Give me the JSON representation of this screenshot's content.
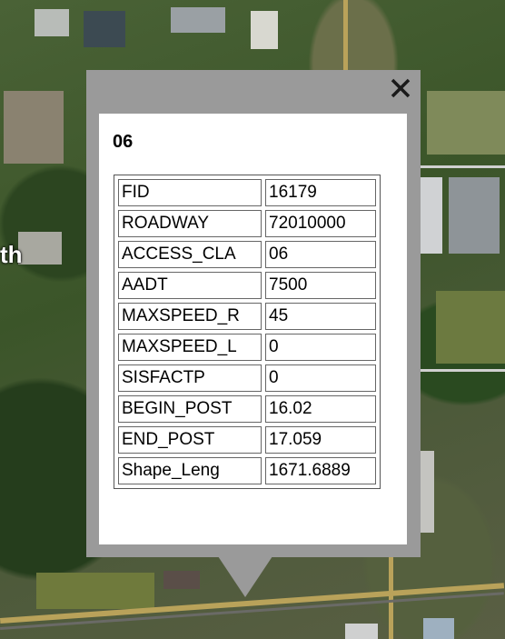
{
  "map": {
    "label": "th"
  },
  "popup": {
    "title": "06",
    "close_icon": "close-icon",
    "rows": [
      {
        "key": "FID",
        "value": "16179"
      },
      {
        "key": "ROADWAY",
        "value": "72010000"
      },
      {
        "key": "ACCESS_CLA",
        "value": "06"
      },
      {
        "key": "AADT",
        "value": "7500"
      },
      {
        "key": "MAXSPEED_R",
        "value": "45"
      },
      {
        "key": "MAXSPEED_L",
        "value": "0"
      },
      {
        "key": "SISFACTP",
        "value": "0"
      },
      {
        "key": "BEGIN_POST",
        "value": "16.02"
      },
      {
        "key": "END_POST",
        "value": "17.059"
      },
      {
        "key": "Shape_Leng",
        "value": "1671.6889"
      }
    ]
  },
  "colors": {
    "popup_frame": "#9a9a9a",
    "popup_body": "#ffffff",
    "road": "#b9a25a"
  }
}
